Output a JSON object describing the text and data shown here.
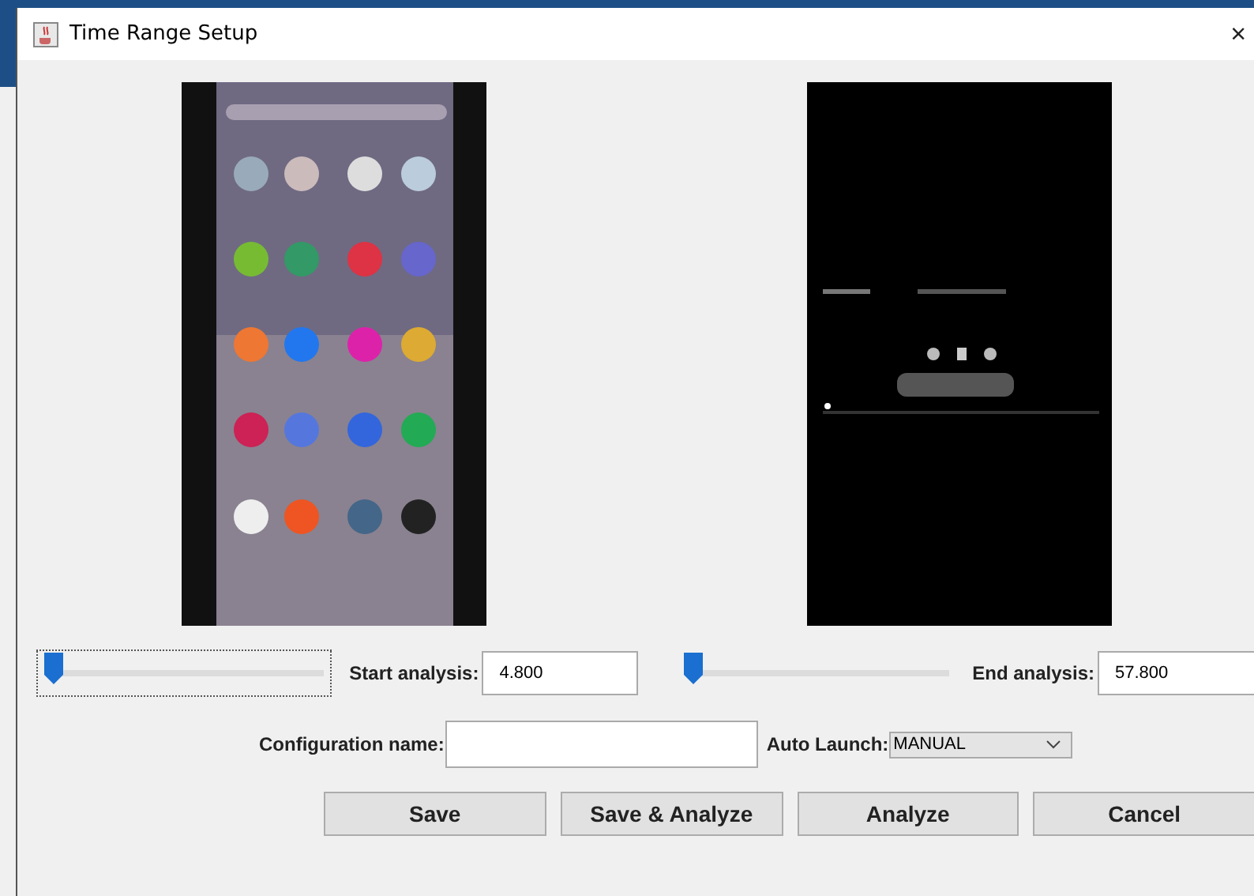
{
  "window": {
    "title": "Time Range Setup",
    "close": "×"
  },
  "start": {
    "level": 0,
    "label": "Start analysis:",
    "value": "4.800",
    "focused": true
  },
  "end": {
    "level": 0,
    "label": "End analysis:",
    "value": "57.800",
    "focused": false
  },
  "config": {
    "label": "Configuration name:"
  },
  "auto_launch": {
    "label": "Auto Launch:",
    "value": "MANUAL"
  },
  "buttons": [
    "Save",
    "Save & Analyze",
    "Analyze",
    "Cancel"
  ]
}
